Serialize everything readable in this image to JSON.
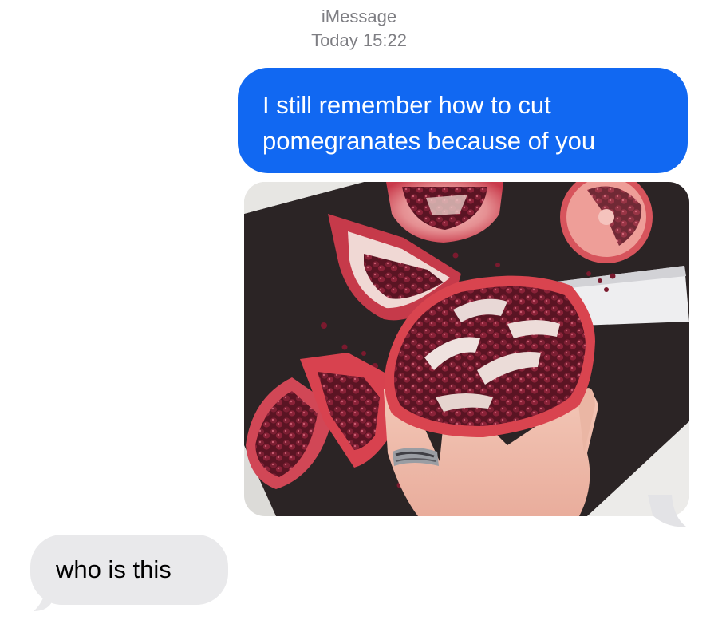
{
  "header": {
    "service": "iMessage",
    "timestamp": "Today 15:22"
  },
  "messages": [
    {
      "direction": "outgoing",
      "text": "I still remember how to cut pomegranates because of you"
    },
    {
      "direction": "outgoing",
      "type": "photo"
    },
    {
      "direction": "incoming",
      "text": "who is this"
    }
  ],
  "colors": {
    "outgoing_bubble": "#1168f2",
    "incoming_bubble": "#e9e9eb",
    "meta_text": "#7e7e83"
  }
}
